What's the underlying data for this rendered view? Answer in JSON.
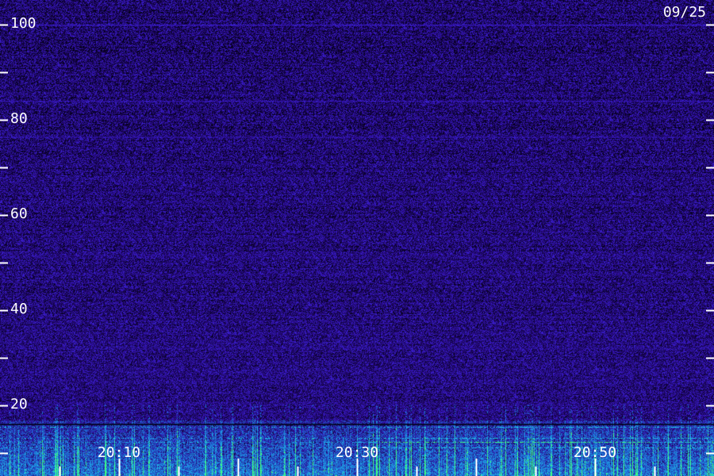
{
  "chart_data": {
    "type": "heatmap",
    "date": "09/25",
    "y_ticks": {
      "labeled": [
        20,
        40,
        60,
        80,
        100
      ],
      "unlabeled": [
        10,
        30,
        50,
        70,
        90
      ]
    },
    "x_ticks": {
      "labeled": [
        "20:10",
        "20:30",
        "20:50"
      ]
    },
    "ylim": [
      10,
      100
    ],
    "xlim": [
      "20:00",
      "21:00"
    ],
    "colors": {
      "background": "#0a0030",
      "noise_dark": "#05001a",
      "noise_mid": "#2a0a8a",
      "noise_bright": "#3a20d0",
      "band_low": "#1e6ad8",
      "band_cyan": "#20c8e8",
      "band_green": "#40ff80",
      "tick": "#ffffff",
      "text": "#ffffff"
    }
  }
}
